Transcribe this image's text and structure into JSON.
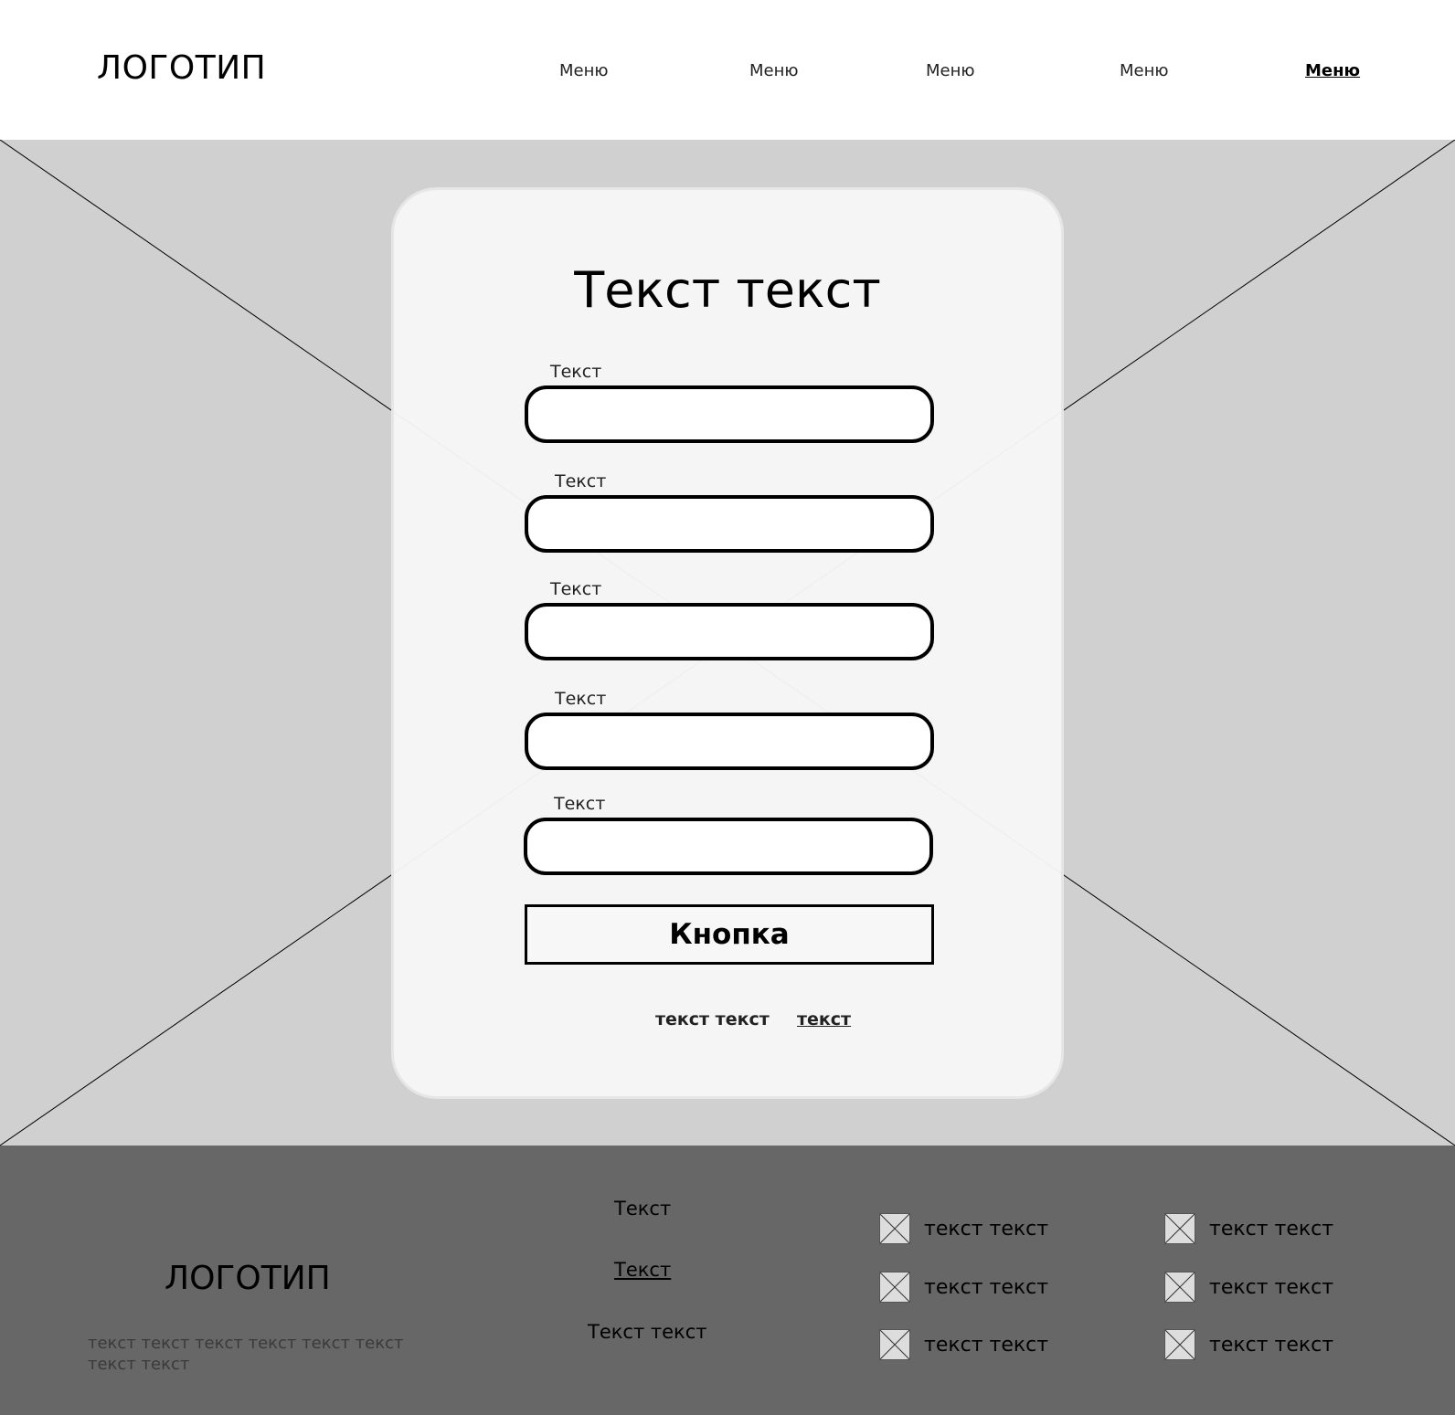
{
  "header": {
    "logo": "ЛОГОТИП",
    "menu": [
      {
        "label": "Меню",
        "active": false
      },
      {
        "label": "Меню",
        "active": false
      },
      {
        "label": "Меню",
        "active": false
      },
      {
        "label": "Меню",
        "active": false
      },
      {
        "label": "Меню",
        "active": true
      }
    ]
  },
  "hero": {
    "image_placeholder_icon": "image-placeholder-icon"
  },
  "form": {
    "title": "Текст текст",
    "fields": [
      {
        "label": "Текст",
        "value": ""
      },
      {
        "label": "Текст",
        "value": ""
      },
      {
        "label": "Текст",
        "value": ""
      },
      {
        "label": "Текст",
        "value": ""
      },
      {
        "label": "Текст",
        "value": ""
      }
    ],
    "button_label": "Кнопка",
    "note": "текст текст",
    "link": "текст"
  },
  "footer": {
    "logo": "ЛОГОТИП",
    "description": "текст текст текст текст текст текст текст текст",
    "links": [
      "Текст",
      "Текст",
      "Текст текст"
    ],
    "items_col1": [
      "текст текст",
      "текст текст",
      "текст текст"
    ],
    "items_col2": [
      "текст текст",
      "текст текст",
      "текст текст"
    ],
    "item_icon": "image-placeholder-icon"
  },
  "colors": {
    "hero_bg": "#d0d0d0",
    "card_bg": "#f7f7f7",
    "footer_bg": "#676767"
  }
}
